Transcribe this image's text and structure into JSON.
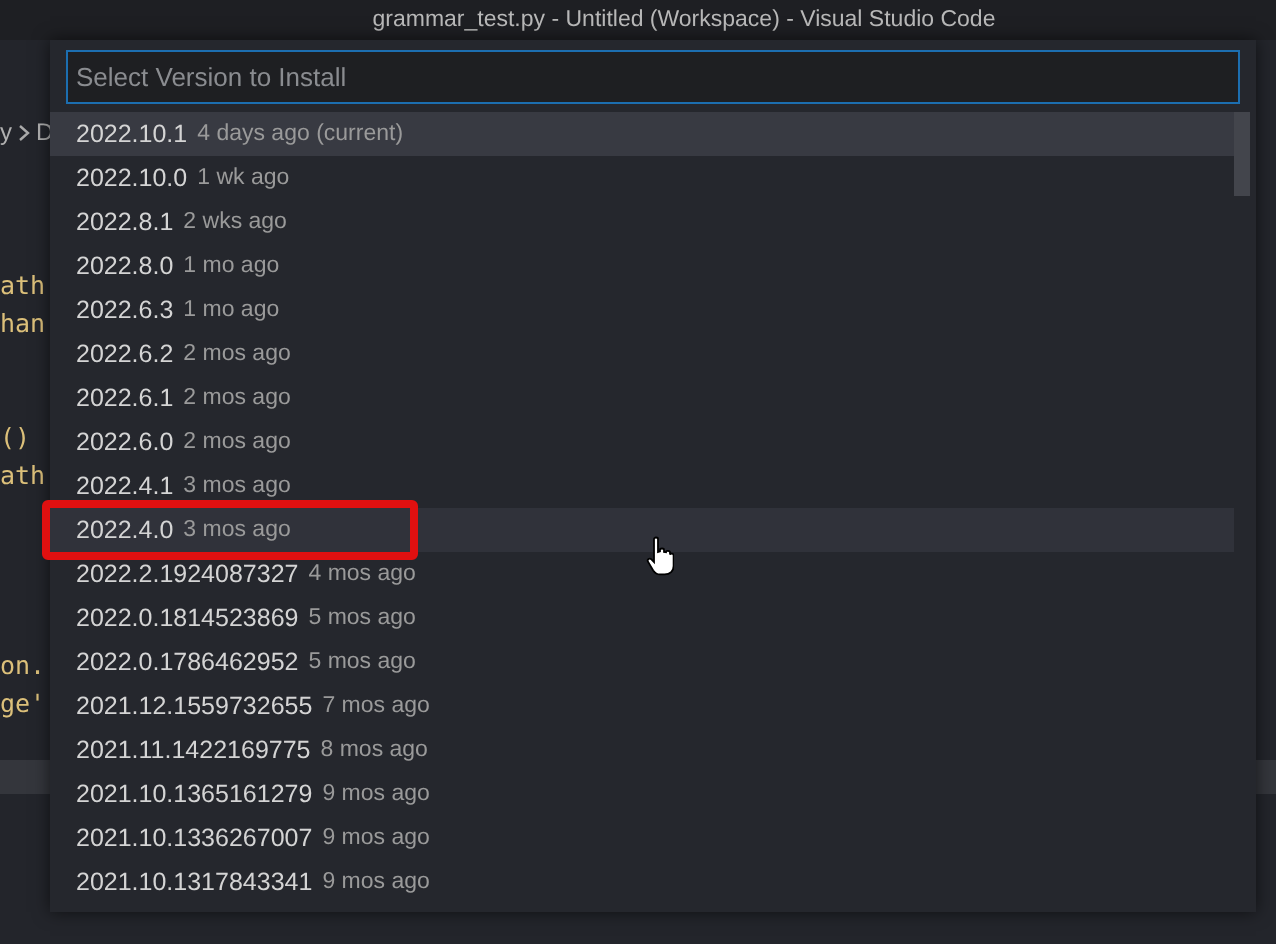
{
  "window": {
    "title": "grammar_test.py - Untitled (Workspace) - Visual Studio Code"
  },
  "editor": {
    "breadcrumb": [
      "y",
      "D"
    ],
    "code_lines": [
      "ath",
      "han",
      "()",
      "ath",
      "on.",
      "ge'"
    ]
  },
  "quick_pick": {
    "placeholder": "Select Version to Install",
    "items": [
      {
        "version": "2022.10.1",
        "detail": "4 days ago (current)",
        "selected": true,
        "hovered": false,
        "outlined": false
      },
      {
        "version": "2022.10.0",
        "detail": "1 wk ago",
        "selected": false,
        "hovered": false,
        "outlined": false
      },
      {
        "version": "2022.8.1",
        "detail": "2 wks ago",
        "selected": false,
        "hovered": false,
        "outlined": false
      },
      {
        "version": "2022.8.0",
        "detail": "1 mo ago",
        "selected": false,
        "hovered": false,
        "outlined": false
      },
      {
        "version": "2022.6.3",
        "detail": "1 mo ago",
        "selected": false,
        "hovered": false,
        "outlined": false
      },
      {
        "version": "2022.6.2",
        "detail": "2 mos ago",
        "selected": false,
        "hovered": false,
        "outlined": false
      },
      {
        "version": "2022.6.1",
        "detail": "2 mos ago",
        "selected": false,
        "hovered": false,
        "outlined": false
      },
      {
        "version": "2022.6.0",
        "detail": "2 mos ago",
        "selected": false,
        "hovered": false,
        "outlined": false
      },
      {
        "version": "2022.4.1",
        "detail": "3 mos ago",
        "selected": false,
        "hovered": false,
        "outlined": false
      },
      {
        "version": "2022.4.0",
        "detail": "3 mos ago",
        "selected": false,
        "hovered": true,
        "outlined": true
      },
      {
        "version": "2022.2.1924087327",
        "detail": "4 mos ago",
        "selected": false,
        "hovered": false,
        "outlined": false
      },
      {
        "version": "2022.0.1814523869",
        "detail": "5 mos ago",
        "selected": false,
        "hovered": false,
        "outlined": false
      },
      {
        "version": "2022.0.1786462952",
        "detail": "5 mos ago",
        "selected": false,
        "hovered": false,
        "outlined": false
      },
      {
        "version": "2021.12.1559732655",
        "detail": "7 mos ago",
        "selected": false,
        "hovered": false,
        "outlined": false
      },
      {
        "version": "2021.11.1422169775",
        "detail": "8 mos ago",
        "selected": false,
        "hovered": false,
        "outlined": false
      },
      {
        "version": "2021.10.1365161279",
        "detail": "9 mos ago",
        "selected": false,
        "hovered": false,
        "outlined": false
      },
      {
        "version": "2021.10.1336267007",
        "detail": "9 mos ago",
        "selected": false,
        "hovered": false,
        "outlined": false
      },
      {
        "version": "2021.10.1317843341",
        "detail": "9 mos ago",
        "selected": false,
        "hovered": false,
        "outlined": false
      }
    ]
  }
}
